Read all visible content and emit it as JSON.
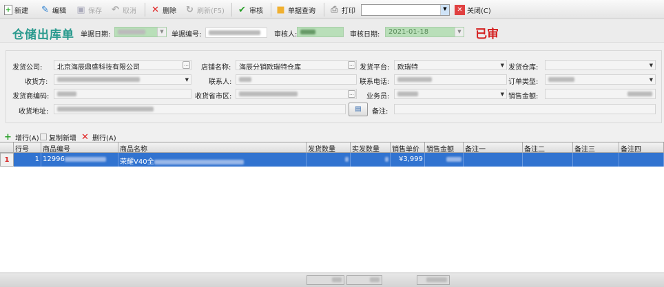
{
  "toolbar": {
    "new": "新建",
    "edit": "编辑",
    "save": "保存",
    "cancel": "取消",
    "delete": "删除",
    "refresh": "刷新(F5)",
    "audit": "审核",
    "query": "单据查询",
    "print": "打印",
    "print_select": "",
    "close": "关闭(C)"
  },
  "header": {
    "title": "仓储出库单",
    "doc_date_label": "单据日期:",
    "doc_no_label": "单据编号:",
    "auditor_label": "审核人:",
    "audit_date_label": "审核日期:",
    "audit_date": "2021-01-18",
    "status": "已审"
  },
  "form": {
    "ship_company_label": "发货公司:",
    "ship_company": "北京海辰鼎盛科技有限公司",
    "shop_name_label": "店铺名称:",
    "shop_name": "海辰分销欧瑞特仓库",
    "platform_label": "发货平台:",
    "platform": "欧瑞特",
    "warehouse_label": "发货仓库:",
    "warehouse": "",
    "receiver_label": "收货方:",
    "contact_label": "联系人:",
    "phone_label": "联系电话:",
    "order_type_label": "订单类型:",
    "supplier_code_label": "发货商编码:",
    "region_label": "收货省市区:",
    "salesman_label": "业务员:",
    "sales_amount_label": "销售金额:",
    "address_label": "收货地址:",
    "remark_label": "备注:",
    "remark": ""
  },
  "rowbar": {
    "add": "增行(A)",
    "copy_add": "复制新增",
    "delete": "删行(A)"
  },
  "grid": {
    "columns": [
      "行号",
      "商品编号",
      "商品名称",
      "发货数量",
      "实发数量",
      "销售单价",
      "销售金额",
      "备注一",
      "备注二",
      "备注三",
      "备注四"
    ],
    "rows": [
      {
        "indicator": "1",
        "line_no": "1",
        "code": "12996",
        "name": "荣耀V40全",
        "ship_qty": "",
        "actual_qty": "",
        "unit_price": "¥3,999",
        "amount": "",
        "r1": "",
        "r2": "",
        "r3": "",
        "r4": ""
      }
    ]
  },
  "colors": {
    "accent": "#2a9a8e",
    "selected": "#3173d0",
    "status": "#d42020"
  }
}
